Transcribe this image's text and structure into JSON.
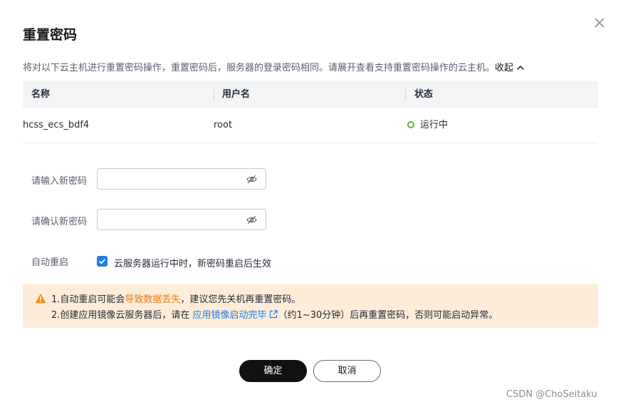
{
  "dialog": {
    "title": "重置密码",
    "description": "将对以下云主机进行重置密码操作，重置密码后，服务器的登录密码相同。请展开查看支持重置密码操作的云主机。",
    "collapse_label": "收起"
  },
  "table": {
    "headers": [
      "名称",
      "用户名",
      "状态"
    ],
    "rows": [
      {
        "name": "hcss_ecs_bdf4",
        "username": "root",
        "status": "运行中"
      }
    ]
  },
  "form": {
    "new_password_label": "请输入新密码",
    "new_password_value": "",
    "confirm_password_label": "请确认新密码",
    "confirm_password_value": "",
    "auto_restart_label": "自动重启",
    "auto_restart_checked": true,
    "auto_restart_text": "云服务器运行中时，新密码重启后生效"
  },
  "alert": {
    "line1_prefix": "1.自动重启可能会",
    "line1_highlight": "导致数据丢失",
    "line1_suffix": "，建议您先关机再重置密码。",
    "line2_prefix": "2.创建应用镜像云服务器后，请在 ",
    "line2_link": "应用镜像启动完毕",
    "line2_suffix": "（约1~30分钟）后再重置密码，否则可能启动异常。"
  },
  "buttons": {
    "ok": "确定",
    "cancel": "取消"
  },
  "watermark": "CSDN @ChoSeitaku",
  "colors": {
    "primary_button": "#111111",
    "link": "#1e7ee4",
    "warning_bg": "#fdecd8",
    "warning_icon": "#f08f1c",
    "danger_text": "#e87c12",
    "status_running": "#5fb333"
  },
  "icons": [
    "close-icon",
    "chevron-up-icon",
    "eye-off-icon",
    "check-icon",
    "warning-icon",
    "external-link-icon",
    "status-dot-icon"
  ]
}
